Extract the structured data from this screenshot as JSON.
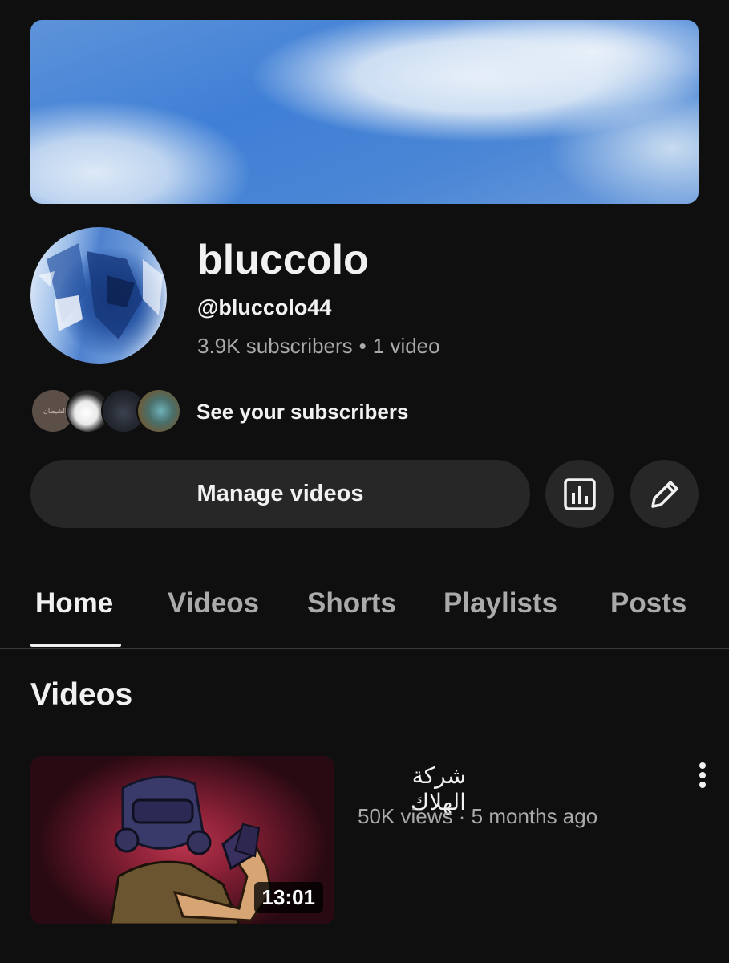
{
  "channel": {
    "name": "bluccolo",
    "handle": "@bluccolo44",
    "subscribers": "3.9K subscribers",
    "separator": "•",
    "video_count": "1 video"
  },
  "subscribers_row": {
    "label": "See your subscribers",
    "first_avatar_text": "الشيطان"
  },
  "actions": {
    "manage_label": "Manage videos",
    "analytics_icon": "bar-chart-icon",
    "edit_icon": "pencil-icon"
  },
  "tabs": [
    {
      "label": "Home",
      "active": true
    },
    {
      "label": "Videos",
      "active": false
    },
    {
      "label": "Shorts",
      "active": false
    },
    {
      "label": "Playlists",
      "active": false
    },
    {
      "label": "Posts",
      "active": false
    }
  ],
  "section": {
    "title": "Videos"
  },
  "videos": [
    {
      "title": "شركة الهلاك",
      "views": "50K views",
      "separator": "·",
      "age": "5 months ago",
      "duration": "13:01"
    }
  ],
  "colors": {
    "background": "#0f0f0f",
    "button_bg": "#272727",
    "text_primary": "#f1f1f1",
    "text_secondary": "#aaaaaa"
  }
}
